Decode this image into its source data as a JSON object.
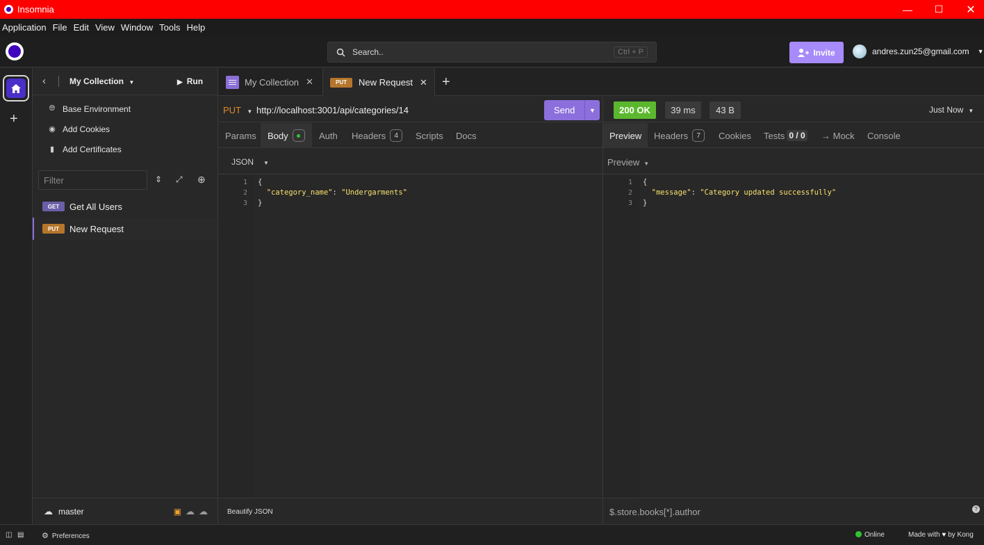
{
  "window": {
    "title": "Insomnia"
  },
  "menu": [
    "Application",
    "File",
    "Edit",
    "View",
    "Window",
    "Tools",
    "Help"
  ],
  "topbar": {
    "search_placeholder": "Search..",
    "search_shortcut": "Ctrl + P",
    "invite_label": "Invite",
    "user_email": "andres.zun25@gmail.com"
  },
  "sidebar": {
    "collection_name": "My Collection",
    "run_label": "Run",
    "links": [
      {
        "label": "Base Environment",
        "icon": "globe-icon"
      },
      {
        "label": "Add Cookies",
        "icon": "cookie-icon"
      },
      {
        "label": "Add Certificates",
        "icon": "certificate-icon"
      }
    ],
    "filter_placeholder": "Filter",
    "requests": [
      {
        "method": "GET",
        "name": "Get All Users",
        "color": "#6a5fa8"
      },
      {
        "method": "PUT",
        "name": "New Request",
        "color": "#b5762c"
      }
    ],
    "branch": "master"
  },
  "tabs": [
    {
      "label": "My Collection"
    },
    {
      "label": "New Request",
      "method": "PUT"
    }
  ],
  "request": {
    "method": "PUT",
    "url": "http://localhost:3001/api/categories/14",
    "send_label": "Send",
    "tabs": [
      {
        "label": "Params"
      },
      {
        "label": "Body"
      },
      {
        "label": "Auth"
      },
      {
        "label": "Headers",
        "count": "4"
      },
      {
        "label": "Scripts"
      },
      {
        "label": "Docs"
      }
    ],
    "body_format": "JSON",
    "body_lines": [
      "1",
      "2",
      "3"
    ],
    "body_key": "\"category_name\"",
    "body_value": "\"Undergarments\"",
    "beautify_label": "Beautify JSON"
  },
  "response": {
    "status": "200 OK",
    "status_color": "#5bb82e",
    "time": "39 ms",
    "size": "43 B",
    "when": "Just Now",
    "tabs": [
      {
        "label": "Preview"
      },
      {
        "label": "Headers",
        "count": "7"
      },
      {
        "label": "Cookies"
      },
      {
        "label": "Tests",
        "count": "0 / 0"
      },
      {
        "label": "→ Mock"
      },
      {
        "label": "Console"
      }
    ],
    "preview_mode": "Preview",
    "body_lines": [
      "1",
      "2",
      "3"
    ],
    "body_key": "\"message\"",
    "body_value": "\"Category updated successfully\"",
    "filter_placeholder": "$.store.books[*].author"
  },
  "footer": {
    "preferences": "Preferences",
    "online": "Online",
    "made_with": "Made with",
    "by": "by Kong"
  }
}
